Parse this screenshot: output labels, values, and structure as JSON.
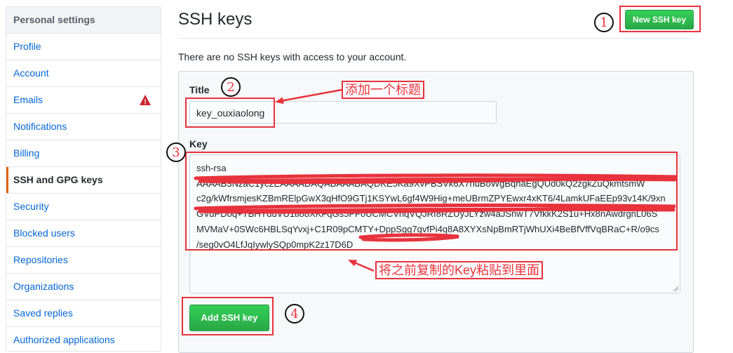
{
  "sidebar": {
    "header": "Personal settings",
    "items": [
      {
        "label": "Profile",
        "name": "sidebar-item-profile"
      },
      {
        "label": "Account",
        "name": "sidebar-item-account"
      },
      {
        "label": "Emails",
        "name": "sidebar-item-emails",
        "icon": "warning-icon"
      },
      {
        "label": "Notifications",
        "name": "sidebar-item-notifications"
      },
      {
        "label": "Billing",
        "name": "sidebar-item-billing"
      },
      {
        "label": "SSH and GPG keys",
        "name": "sidebar-item-ssh-gpg-keys",
        "selected": true
      },
      {
        "label": "Security",
        "name": "sidebar-item-security"
      },
      {
        "label": "Blocked users",
        "name": "sidebar-item-blocked-users"
      },
      {
        "label": "Repositories",
        "name": "sidebar-item-repositories"
      },
      {
        "label": "Organizations",
        "name": "sidebar-item-organizations"
      },
      {
        "label": "Saved replies",
        "name": "sidebar-item-saved-replies"
      },
      {
        "label": "Authorized applications",
        "name": "sidebar-item-authorized-applications"
      }
    ]
  },
  "main": {
    "title": "SSH keys",
    "new_key_button": "New SSH key",
    "empty_message": "There are no SSH keys with access to your account."
  },
  "form": {
    "title_label": "Title",
    "title_value": "key_ouxiaolong",
    "key_label": "Key",
    "key_lines": [
      "ssh-rsa",
      "AAAAB3NzaC1yc2EAAAADAQABAAABAQDKE5Ka9XvPBSVk6X7huBoWgBqnaEgQUd0kQ2zgkZuQkmtsmW",
      "c2g/kWfrsmjesKZBmRElpGwX3qHfO9GTj1KSYwL6gf4W9Hig+meUBrmZPYEwxr4xKT6/4LamkUFaEEp93v14K/9xn",
      "GVuPDoq+TBHYduVU1ti88XKFqGs5PF0UCMCVnqVQJRf8RZUyJLYzw4aJSnwT7VfkkK2S1u+Hx8nAwdrgnL06S",
      "MVMaV+0SWc6HBLSqYvxj+C1R09pCMTY+DppSgg7qvfPi4q8A8XYXsNpBmRTjWhUXi4BeBfVffVqBRaC+R/o9cs",
      "/seg0vO4LfJqIywlySQp0mpK2z17D6D"
    ],
    "submit_button": "Add SSH key"
  },
  "annotations": {
    "step_numbers": [
      "1",
      "2",
      "3",
      "4"
    ],
    "title_note": "添加一个标题",
    "key_note": "将之前复制的Key粘贴到里面"
  },
  "colors": {
    "link": "#0366d6",
    "button_green": "#28a745",
    "annotation_red": "#e8323c",
    "warning_red": "#cb2431",
    "selected_accent": "#e36209"
  }
}
